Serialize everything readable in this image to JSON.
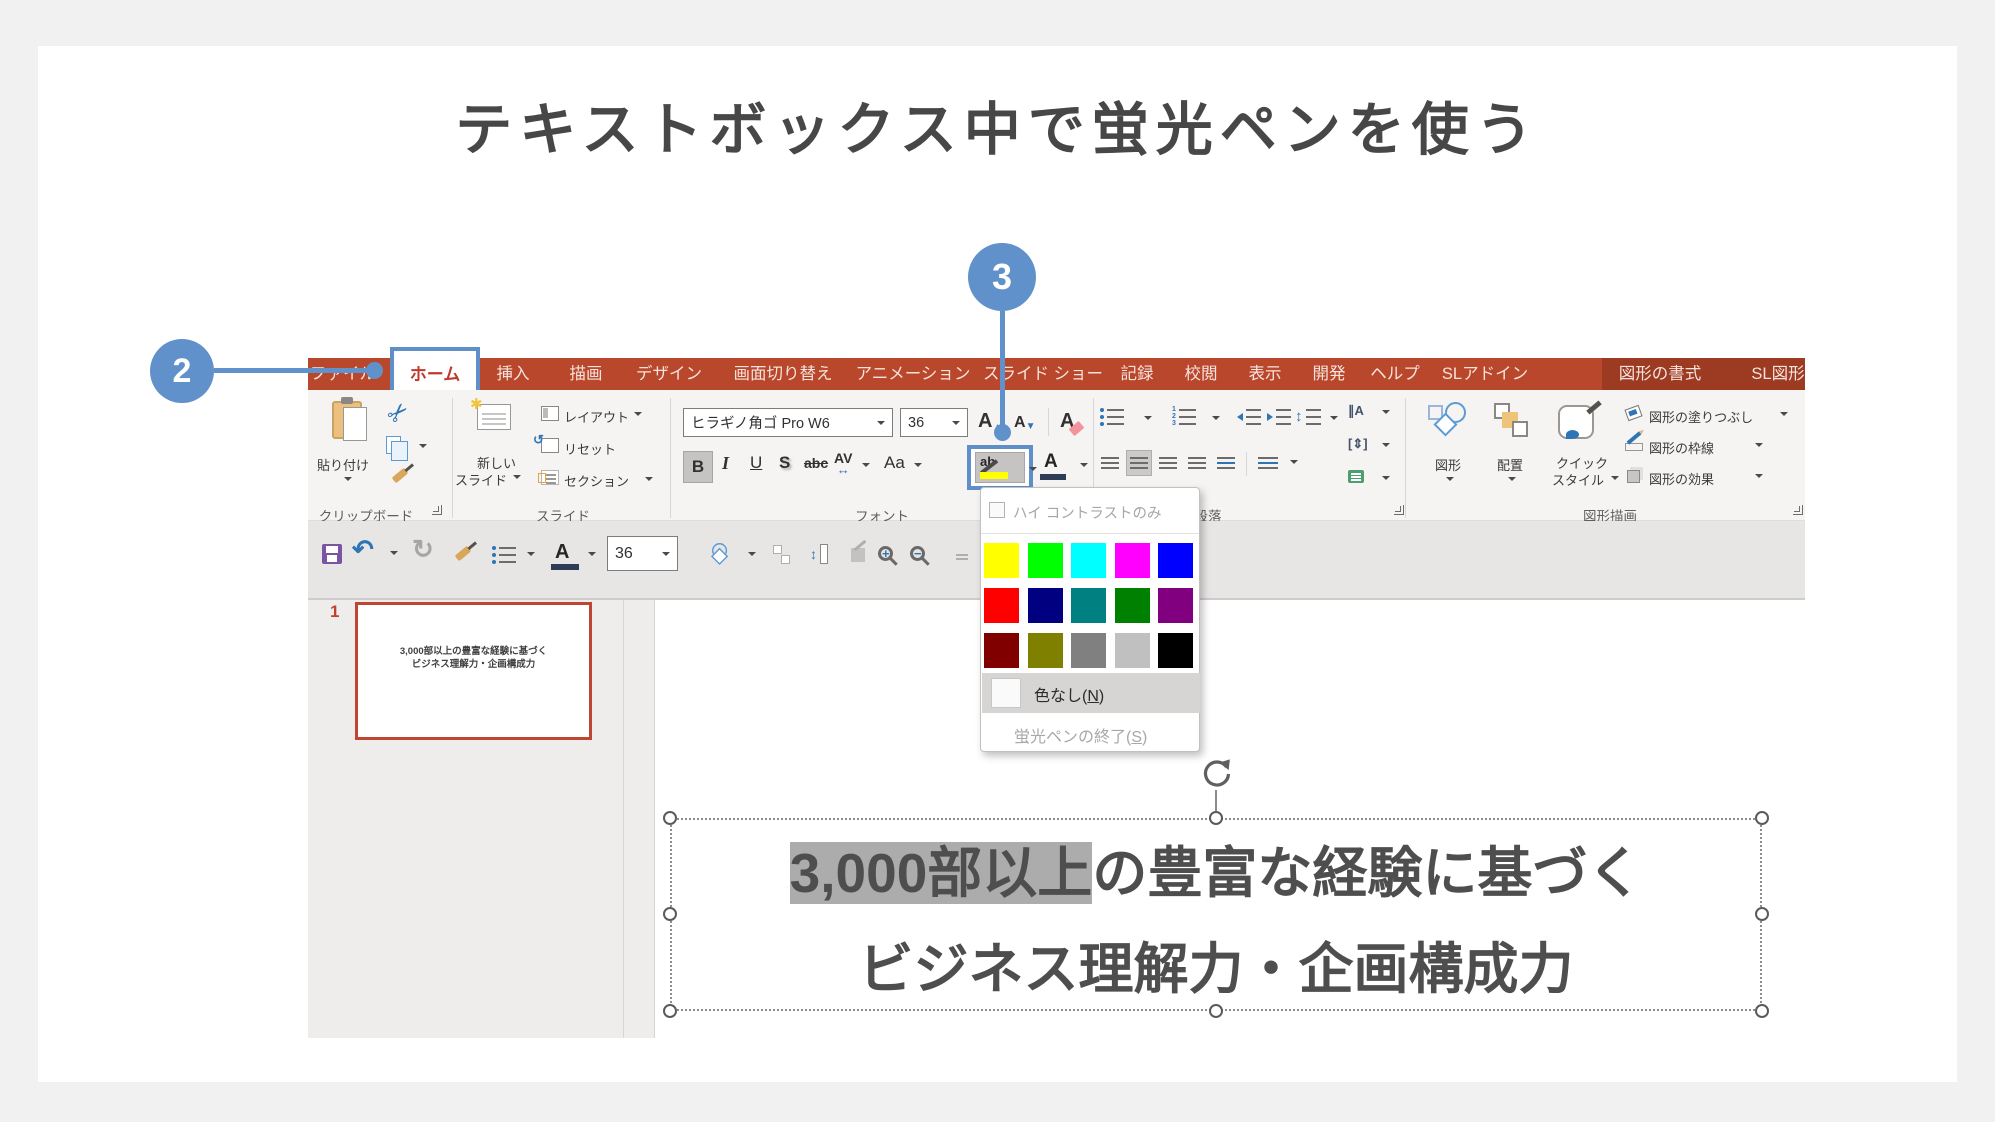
{
  "title": "テキストボックス中で蛍光ペンを使う",
  "callouts": {
    "step2": "2",
    "step3": "3"
  },
  "ribbon": {
    "tabs": [
      "ファイル",
      "ホーム",
      "挿入",
      "描画",
      "デザイン",
      "画面切り替え",
      "アニメーション",
      "スライド ショー",
      "記録",
      "校閲",
      "表示",
      "開発",
      "ヘルプ",
      "SLアドイン",
      "図形の書式",
      "SL図形"
    ],
    "active_tab": "ホーム",
    "contextual_tab": "図形の書式",
    "groups": {
      "clipboard": "クリップボード",
      "slides": "スライド",
      "font": "フォント",
      "paragraph": "段落",
      "drawing": "図形描画"
    },
    "buttons": {
      "paste": "貼り付け",
      "new_slide_line1": "新しい",
      "new_slide_line2": "スライド",
      "layout": "レイアウト",
      "reset": "リセット",
      "section": "セクション",
      "bold": "B",
      "italic": "I",
      "underline": "U",
      "strike_s": "S",
      "strike_abc": "abc",
      "spacing_av": "AV",
      "case_aa": "Aa",
      "highlight_ab": "ab",
      "font_color_a": "A",
      "grow_font": "A",
      "shrink_font": "A",
      "clear_format": "A",
      "shapes": "図形",
      "arrange": "配置",
      "quick_style_line1": "クイック",
      "quick_style_line2": "スタイル",
      "shape_fill": "図形の塗りつぶし",
      "shape_outline": "図形の枠線",
      "shape_effects": "図形の効果"
    },
    "font_name": "ヒラギノ角ゴ Pro W6",
    "font_size": "36"
  },
  "qat": {
    "font_size": "36"
  },
  "highlight_dropdown": {
    "high_contrast_label": "ハイ コントラストのみ",
    "colors": [
      "#ffff00",
      "#00ff00",
      "#00ffff",
      "#ff00ff",
      "#0000ff",
      "#ff0000",
      "#000080",
      "#008080",
      "#008000",
      "#800080",
      "#800000",
      "#808000",
      "#808080",
      "#c0c0c0",
      "#000000"
    ],
    "no_color_pre": "色なし(",
    "no_color_key": "N",
    "no_color_post": ")",
    "stop_pre": "蛍光ペンの終了(",
    "stop_key": "S",
    "stop_post": ")"
  },
  "slide_panel": {
    "slide_number": "1",
    "thumb_line1": "3,000部以上の豊富な経験に基づく",
    "thumb_line2": "ビジネス理解力・企画構成力"
  },
  "slide": {
    "line1_highlighted": "3,000部以上",
    "line1_rest": "の豊富な経験に基づく",
    "line2": "ビジネス理解力・企画構成力"
  }
}
